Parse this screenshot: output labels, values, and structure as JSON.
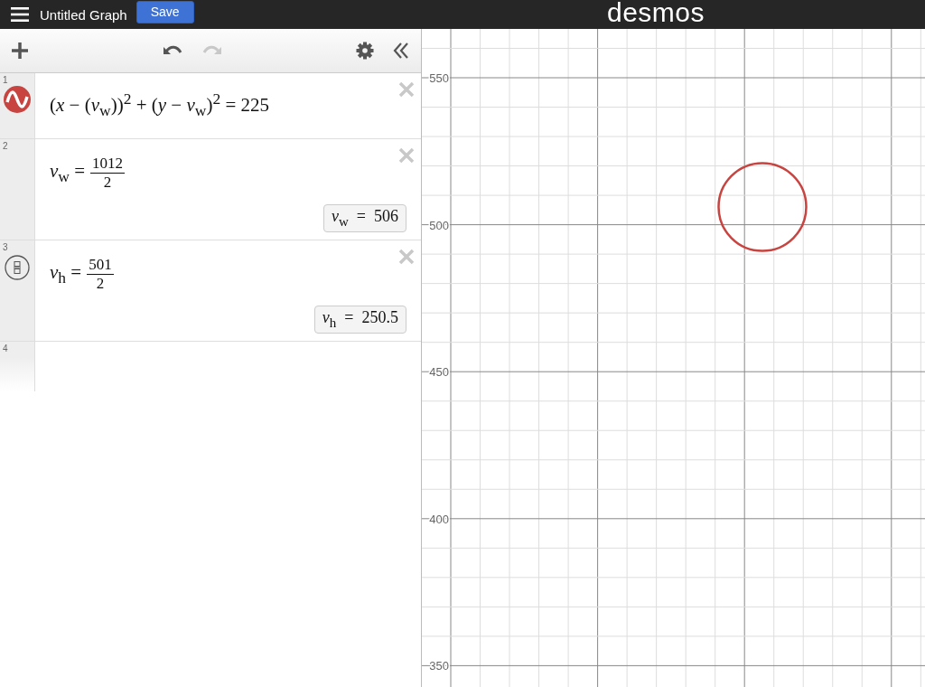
{
  "header": {
    "title": "Untitled Graph",
    "save_label": "Save",
    "logo": "desmos"
  },
  "toolbar": {
    "undo_disabled": false,
    "redo_disabled": true
  },
  "expressions": [
    {
      "number": "1",
      "kind": "curve",
      "color": "#c74440",
      "latex": "(*x* − (*v*$_{w}$))$^{2}$ + (*y* − *v*$_{w}$)$^{2}$ = 225"
    },
    {
      "number": "2",
      "kind": "fraction",
      "lhs": "*v*$_{w}$ =",
      "numerator": "1012",
      "denominator": "2",
      "result": "*v*$_{w}$  =  506"
    },
    {
      "number": "3",
      "kind": "fraction_toggle",
      "lhs": "*v*$_{h}$ =",
      "numerator": "501",
      "denominator": "2",
      "result": "*v*$_{h}$  =  250.5"
    },
    {
      "number": "4",
      "kind": "empty"
    }
  ],
  "graph": {
    "y_labels": [
      "550",
      "500",
      "450",
      "400",
      "350"
    ]
  }
}
